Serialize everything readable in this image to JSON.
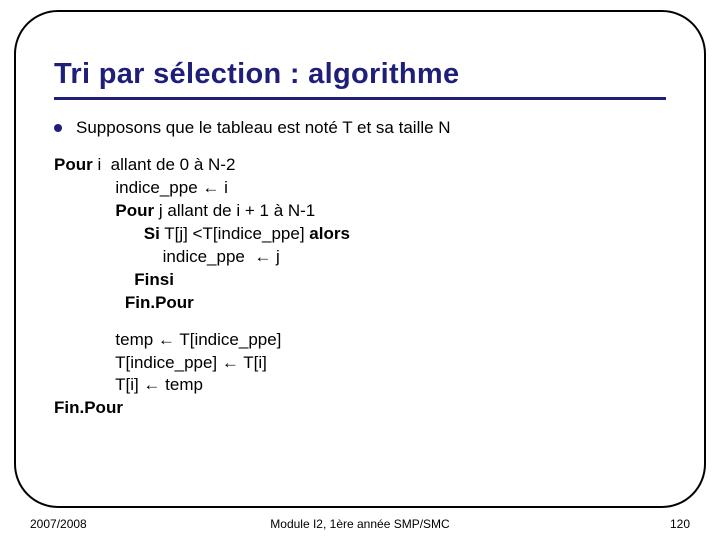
{
  "title": "Tri par sélection : algorithme",
  "bullet": "Supposons que le tableau est noté T et sa taille N",
  "algo": {
    "l1_kw": "Pour",
    "l1_rest": " i  allant de 0 à N-2",
    "l2": "indice_ppe ← i",
    "l3_kw": "Pour",
    "l3_rest": " j allant de i + 1 à N-1",
    "l4_kw": "Si",
    "l4_mid": " T[j] <T[indice_ppe] ",
    "l4_kw2": "alors",
    "l5": "indice_ppe  ← j",
    "l6_kw": "Finsi",
    "l7_kw": "Fin.Pour",
    "l8": "temp ← T[indice_ppe]",
    "l9": "T[indice_ppe] ← T[i]",
    "l10": "T[i] ← temp",
    "l11_kw": "Fin.Pour"
  },
  "footer": {
    "left": "2007/2008",
    "center": "Module I2, 1ère année SMP/SMC",
    "right": "120"
  }
}
